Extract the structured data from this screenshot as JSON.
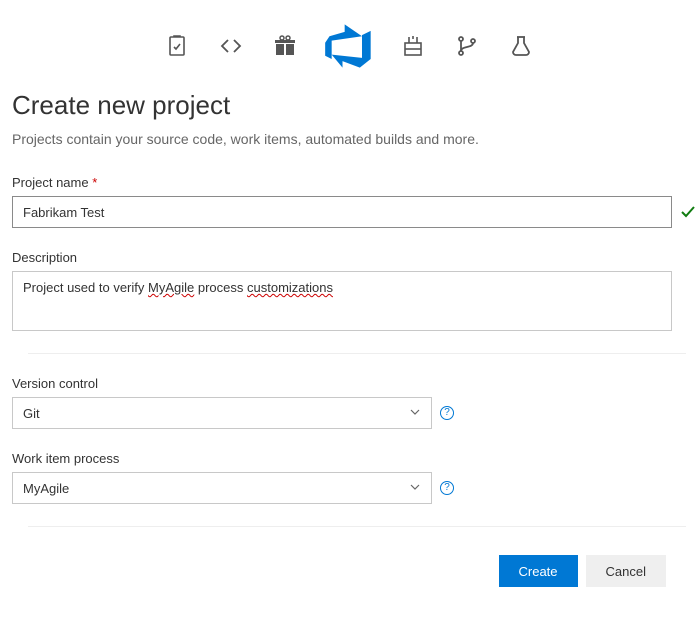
{
  "header": {
    "title": "Create new project",
    "subtitle": "Projects contain your source code, work items, automated builds and more."
  },
  "nav_icons": [
    {
      "name": "boards-icon"
    },
    {
      "name": "code-icon"
    },
    {
      "name": "gift-icon"
    },
    {
      "name": "azure-devops-icon",
      "active": true
    },
    {
      "name": "pipelines-icon"
    },
    {
      "name": "repos-branch-icon"
    },
    {
      "name": "test-plans-icon"
    }
  ],
  "form": {
    "project_name": {
      "label": "Project name",
      "required_mark": "*",
      "value": "Fabrikam Test",
      "valid": true
    },
    "description": {
      "label": "Description",
      "value_parts": [
        "Project used to verify ",
        "MyAgile",
        " process ",
        "customizations"
      ]
    },
    "version_control": {
      "label": "Version control",
      "value": "Git"
    },
    "work_item_process": {
      "label": "Work item process",
      "value": "MyAgile"
    }
  },
  "buttons": {
    "create": "Create",
    "cancel": "Cancel"
  }
}
